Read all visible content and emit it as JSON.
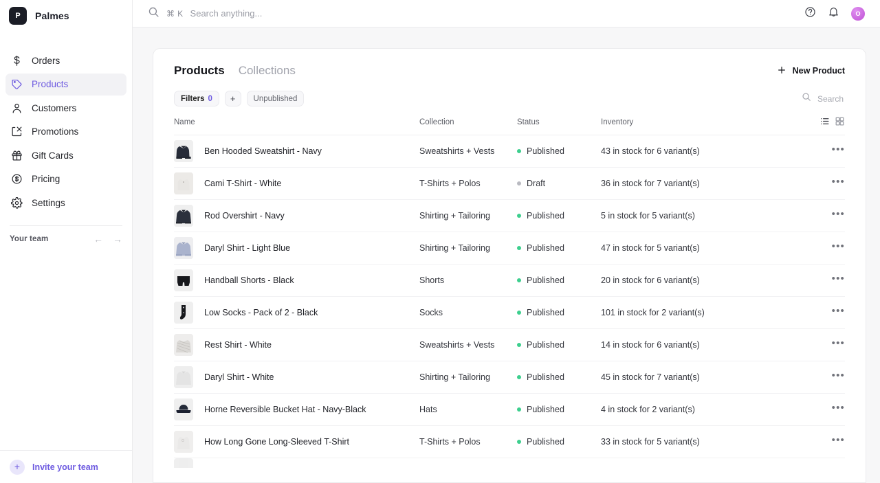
{
  "brand": {
    "initial": "P",
    "name": "Palmes"
  },
  "sidebar": {
    "items": [
      {
        "label": "Orders",
        "icon": "dollar-icon"
      },
      {
        "label": "Products",
        "icon": "tag-icon"
      },
      {
        "label": "Customers",
        "icon": "user-icon"
      },
      {
        "label": "Promotions",
        "icon": "discount-icon"
      },
      {
        "label": "Gift Cards",
        "icon": "gift-icon"
      },
      {
        "label": "Pricing",
        "icon": "circle-dollar-icon"
      },
      {
        "label": "Settings",
        "icon": "gear-icon"
      }
    ],
    "team_label": "Your team",
    "prev_arrow": "←",
    "next_arrow": "→",
    "invite_label": "Invite your team",
    "invite_plus": "+",
    "active_item": "Products",
    "active_color": "#6d5ae0"
  },
  "topbar": {
    "search_shortcut": "⌘ K",
    "search_placeholder": "Search anything...",
    "help_icon": "help-circle-icon",
    "notification_icon": "bell-icon",
    "avatar_initial": "O",
    "avatar_color": "#c963dd"
  },
  "page": {
    "tabs": [
      {
        "label": "Products",
        "active": true
      },
      {
        "label": "Collections",
        "active": false
      }
    ],
    "new_product_label": "New Product",
    "new_product_icon": "plus-icon",
    "filters": {
      "filters_label": "Filters",
      "filters_count": "0",
      "add_filter_icon": "+",
      "unpublished_label": "Unpublished"
    },
    "table_search_placeholder": "Search",
    "table_search_icon": "search-icon",
    "view_toggle": {
      "list_icon": "list-view-icon",
      "grid_icon": "grid-view-icon",
      "active": "list"
    }
  },
  "table": {
    "columns": [
      "Name",
      "Collection",
      "Status",
      "Inventory"
    ],
    "rows": [
      {
        "name": "Ben Hooded Sweatshirt - Navy",
        "collection": "Sweatshirts + Vests",
        "status": "Published",
        "status_type": "published",
        "inventory": "43 in stock for 6 variant(s)",
        "thumb": "hoodie-navy"
      },
      {
        "name": "Cami T-Shirt - White",
        "collection": "T-Shirts + Polos",
        "status": "Draft",
        "status_type": "draft",
        "inventory": "36 in stock for 7 variant(s)",
        "thumb": "tshirt-white"
      },
      {
        "name": "Rod Overshirt - Navy",
        "collection": "Shirting + Tailoring",
        "status": "Published",
        "status_type": "published",
        "inventory": "5 in stock for 5 variant(s)",
        "thumb": "shirt-navy"
      },
      {
        "name": "Daryl Shirt - Light Blue",
        "collection": "Shirting + Tailoring",
        "status": "Published",
        "status_type": "published",
        "inventory": "47 in stock for 5 variant(s)",
        "thumb": "shirt-lightblue"
      },
      {
        "name": "Handball Shorts - Black",
        "collection": "Shorts",
        "status": "Published",
        "status_type": "published",
        "inventory": "20 in stock for 6 variant(s)",
        "thumb": "shorts-black"
      },
      {
        "name": "Low Socks - Pack of 2 - Black",
        "collection": "Socks",
        "status": "Published",
        "status_type": "published",
        "inventory": "101 in stock for 2 variant(s)",
        "thumb": "sock-black"
      },
      {
        "name": "Rest Shirt - White",
        "collection": "Sweatshirts + Vests",
        "status": "Published",
        "status_type": "published",
        "inventory": "14 in stock for 6 variant(s)",
        "thumb": "knit-white"
      },
      {
        "name": "Daryl Shirt - White",
        "collection": "Shirting + Tailoring",
        "status": "Published",
        "status_type": "published",
        "inventory": "45 in stock for 7 variant(s)",
        "thumb": "shirt-white"
      },
      {
        "name": "Horne Reversible Bucket Hat - Navy-Black",
        "collection": "Hats",
        "status": "Published",
        "status_type": "published",
        "inventory": "4 in stock for 2 variant(s)",
        "thumb": "hat-navy"
      },
      {
        "name": "How Long Gone Long-Sleeved T-Shirt",
        "collection": "T-Shirts + Polos",
        "status": "Published",
        "status_type": "published",
        "inventory": "33 in stock for 5 variant(s)",
        "thumb": "tee-white"
      }
    ],
    "row_action_icon": "•••",
    "status_colors": {
      "published": "#3dcf8e",
      "draft": "#b9bac1"
    }
  }
}
